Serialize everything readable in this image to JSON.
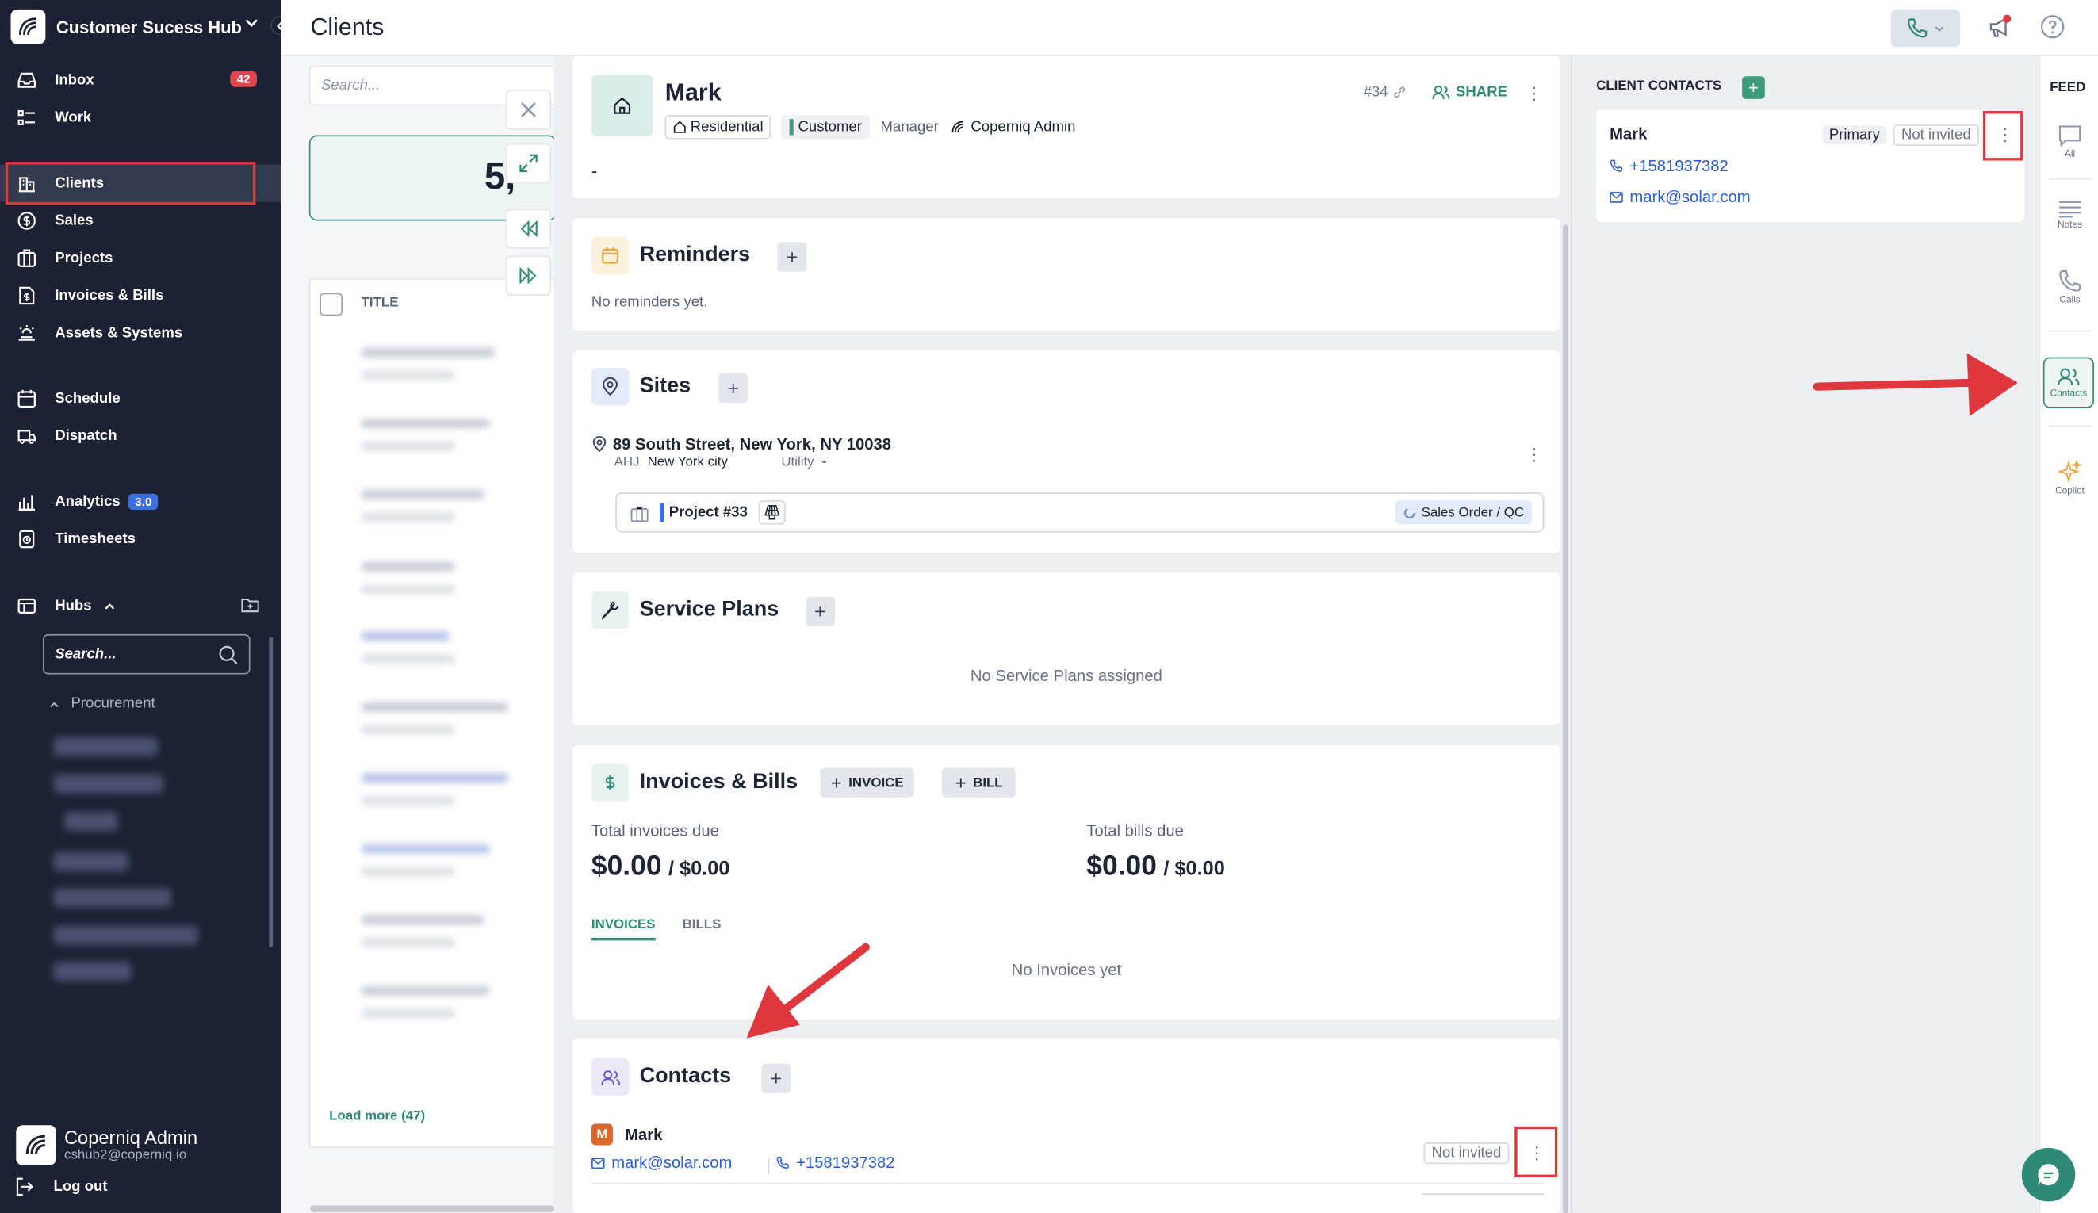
{
  "app": {
    "name": "Customer Sucess Hub",
    "page_title": "Clients"
  },
  "sidebar": {
    "items": [
      {
        "label": "Inbox",
        "badge": "42"
      },
      {
        "label": "Work"
      },
      {
        "label": "Clients"
      },
      {
        "label": "Sales"
      },
      {
        "label": "Projects"
      },
      {
        "label": "Invoices & Bills"
      },
      {
        "label": "Assets & Systems"
      },
      {
        "label": "Schedule"
      },
      {
        "label": "Dispatch"
      },
      {
        "label": "Analytics",
        "badge": "3.0"
      },
      {
        "label": "Timesheets"
      },
      {
        "label": "Hubs"
      }
    ],
    "hub_search_placeholder": "Search...",
    "procurement": "Procurement",
    "user": {
      "name": "Coperniq Admin",
      "email": "cshub2@coperniq.io"
    },
    "logout": "Log out"
  },
  "list": {
    "search_placeholder": "Search...",
    "stat_value": "5,",
    "column_title": "TITLE",
    "load_more": "Load more (47)"
  },
  "client": {
    "name": "Mark",
    "number": "#34",
    "share": "SHARE",
    "type": "Residential",
    "status": "Customer",
    "manager_label": "Manager",
    "manager": "Coperniq Admin",
    "description": "-"
  },
  "reminders": {
    "title": "Reminders",
    "empty": "No reminders yet."
  },
  "sites": {
    "title": "Sites",
    "address": "89 South Street, New York, NY 10038",
    "ahj_label": "AHJ",
    "ahj": "New York city",
    "utility_label": "Utility",
    "utility": "-",
    "project": "Project #33",
    "project_stage": "Sales Order / QC"
  },
  "service_plans": {
    "title": "Service Plans",
    "empty": "No Service Plans assigned"
  },
  "invoices": {
    "title": "Invoices & Bills",
    "invoice_btn": "INVOICE",
    "bill_btn": "BILL",
    "total_invoices_label": "Total invoices due",
    "total_invoices": "$0.00",
    "total_invoices_of": "/ $0.00",
    "total_bills_label": "Total bills due",
    "total_bills": "$0.00",
    "total_bills_of": "/ $0.00",
    "tab_invoices": "INVOICES",
    "tab_bills": "BILLS",
    "empty": "No Invoices yet"
  },
  "contacts": {
    "title": "Contacts",
    "contact": {
      "initial": "M",
      "name": "Mark",
      "email": "mark@solar.com",
      "phone": "+1581937382",
      "invite_status": "Not invited"
    }
  },
  "client_contacts": {
    "title": "CLIENT CONTACTS",
    "contact": {
      "name": "Mark",
      "primary": "Primary",
      "invite_status": "Not invited",
      "phone": "+1581937382",
      "email": "mark@solar.com"
    }
  },
  "feed": {
    "title": "FEED",
    "items": [
      {
        "label": "All"
      },
      {
        "label": "Notes"
      },
      {
        "label": "Calls"
      },
      {
        "label": "Contacts"
      },
      {
        "label": "Copilot"
      }
    ]
  },
  "colors": {
    "sidebar_bg": "#1c2233",
    "accent": "#2e8a74",
    "annotation_red": "#e0373e",
    "link_blue": "#2a5bd7"
  }
}
